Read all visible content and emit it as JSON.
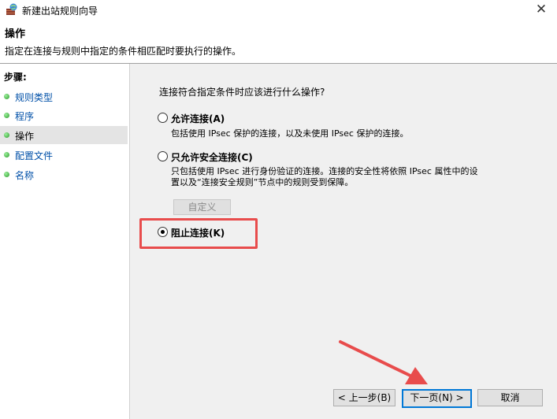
{
  "window": {
    "title": "新建出站规则向导",
    "close_glyph": "✕"
  },
  "header": {
    "title": "操作",
    "description": "指定在连接与规则中指定的条件相匹配时要执行的操作。"
  },
  "sidebar": {
    "title": "步骤:",
    "items": [
      {
        "label": "规则类型"
      },
      {
        "label": "程序"
      },
      {
        "label": "操作"
      },
      {
        "label": "配置文件"
      },
      {
        "label": "名称"
      }
    ]
  },
  "main": {
    "question": "连接符合指定条件时应该进行什么操作?",
    "options": [
      {
        "label": "允许连接(A)",
        "description": "包括使用 IPsec 保护的连接，以及未使用 IPsec 保护的连接。",
        "selected": false
      },
      {
        "label": "只允许安全连接(C)",
        "description_line1": "只包括使用 IPsec 进行身份验证的连接。连接的安全性将依照 IPsec 属性中的设",
        "description_line2": "置以及“连接安全规则”节点中的规则受到保障。",
        "selected": false
      },
      {
        "label": "阻止连接(K)",
        "selected": true
      }
    ],
    "custom_button": "自定义"
  },
  "buttons": {
    "back": "< 上一步(B)",
    "next": "下一页(N) >",
    "cancel": "取消"
  },
  "colors": {
    "highlight": "#e84c4c",
    "link": "#0050a8",
    "focus": "#0078d7"
  }
}
